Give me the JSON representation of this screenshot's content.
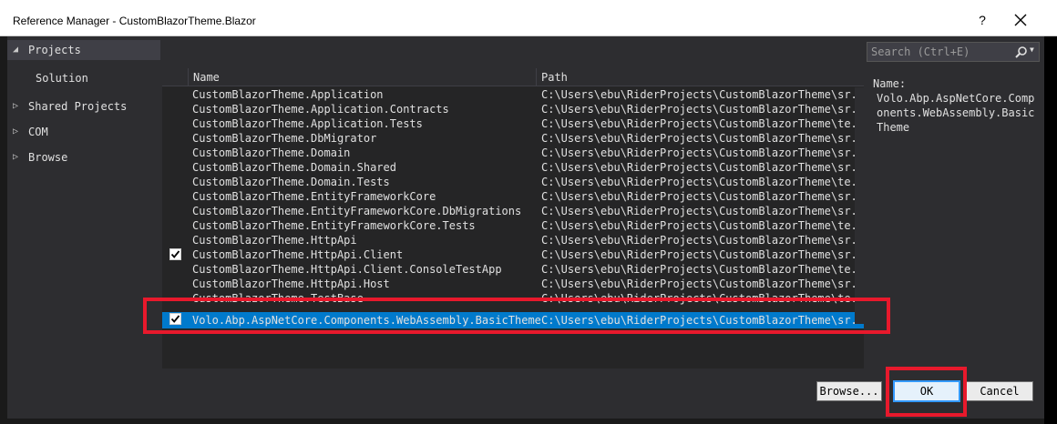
{
  "window": {
    "title": "Reference Manager - CustomBlazorTheme.Blazor",
    "help_label": "?",
    "close_icon": "close-icon"
  },
  "nav": {
    "items": [
      {
        "label": "Projects",
        "arrow": "◢",
        "selected": true
      },
      {
        "label": "Solution",
        "arrow": "",
        "selected": false
      },
      {
        "label": "Shared Projects",
        "arrow": "▷",
        "selected": false
      },
      {
        "label": "COM",
        "arrow": "▷",
        "selected": false
      },
      {
        "label": "Browse",
        "arrow": "▷",
        "selected": false
      }
    ]
  },
  "list": {
    "columns": {
      "name": "Name",
      "path": "Path"
    },
    "rows": [
      {
        "checked": false,
        "name": "CustomBlazorTheme.Application",
        "path": "C:\\Users\\ebu\\RiderProjects\\CustomBlazorTheme\\sr..."
      },
      {
        "checked": false,
        "name": "CustomBlazorTheme.Application.Contracts",
        "path": "C:\\Users\\ebu\\RiderProjects\\CustomBlazorTheme\\sr..."
      },
      {
        "checked": false,
        "name": "CustomBlazorTheme.Application.Tests",
        "path": "C:\\Users\\ebu\\RiderProjects\\CustomBlazorTheme\\te..."
      },
      {
        "checked": false,
        "name": "CustomBlazorTheme.DbMigrator",
        "path": "C:\\Users\\ebu\\RiderProjects\\CustomBlazorTheme\\sr..."
      },
      {
        "checked": false,
        "name": "CustomBlazorTheme.Domain",
        "path": "C:\\Users\\ebu\\RiderProjects\\CustomBlazorTheme\\sr..."
      },
      {
        "checked": false,
        "name": "CustomBlazorTheme.Domain.Shared",
        "path": "C:\\Users\\ebu\\RiderProjects\\CustomBlazorTheme\\sr..."
      },
      {
        "checked": false,
        "name": "CustomBlazorTheme.Domain.Tests",
        "path": "C:\\Users\\ebu\\RiderProjects\\CustomBlazorTheme\\te..."
      },
      {
        "checked": false,
        "name": "CustomBlazorTheme.EntityFrameworkCore",
        "path": "C:\\Users\\ebu\\RiderProjects\\CustomBlazorTheme\\sr..."
      },
      {
        "checked": false,
        "name": "CustomBlazorTheme.EntityFrameworkCore.DbMigrations",
        "path": "C:\\Users\\ebu\\RiderProjects\\CustomBlazorTheme\\sr..."
      },
      {
        "checked": false,
        "name": "CustomBlazorTheme.EntityFrameworkCore.Tests",
        "path": "C:\\Users\\ebu\\RiderProjects\\CustomBlazorTheme\\te..."
      },
      {
        "checked": false,
        "name": "CustomBlazorTheme.HttpApi",
        "path": "C:\\Users\\ebu\\RiderProjects\\CustomBlazorTheme\\sr..."
      },
      {
        "checked": true,
        "name": "CustomBlazorTheme.HttpApi.Client",
        "path": "C:\\Users\\ebu\\RiderProjects\\CustomBlazorTheme\\sr..."
      },
      {
        "checked": false,
        "name": "CustomBlazorTheme.HttpApi.Client.ConsoleTestApp",
        "path": "C:\\Users\\ebu\\RiderProjects\\CustomBlazorTheme\\te..."
      },
      {
        "checked": false,
        "name": "CustomBlazorTheme.HttpApi.Host",
        "path": "C:\\Users\\ebu\\RiderProjects\\CustomBlazorTheme\\sr..."
      },
      {
        "checked": false,
        "name": "CustomBlazorTheme.TestBase",
        "path": "C:\\Users\\ebu\\RiderProjects\\CustomBlazorTheme\\te..."
      },
      {
        "checked": true,
        "selected": true,
        "name": "Volo.Abp.AspNetCore.Components.WebAssembly.BasicTheme",
        "path": "C:\\Users\\ebu\\RiderProjects\\CustomBlazorTheme\\sr..."
      }
    ]
  },
  "search": {
    "placeholder": "Search (Ctrl+E)",
    "value": ""
  },
  "details": {
    "name_label": "Name:",
    "name_value": "Volo.Abp.AspNetCore.Components.WebAssembly.BasicTheme"
  },
  "buttons": {
    "browse": "Browse...",
    "ok": "OK",
    "cancel": "Cancel"
  },
  "colors": {
    "selection": "#007acc",
    "highlight": "#e8192c",
    "background": "#2d2d30"
  }
}
